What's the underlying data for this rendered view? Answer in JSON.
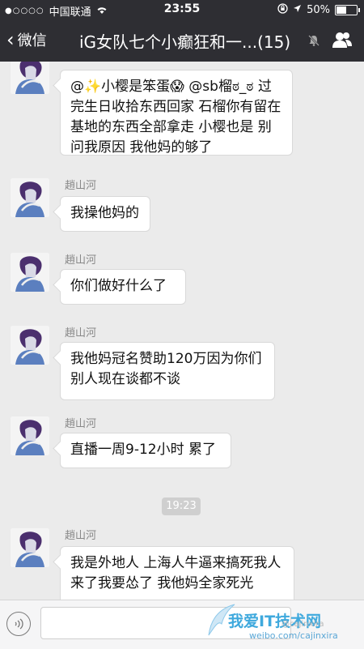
{
  "status_bar": {
    "carrier": "中国联通",
    "time": "23:55",
    "battery": "50%",
    "battery_level": 0.5
  },
  "nav": {
    "back_label": "微信",
    "title": "iG女队七个小癫狂和一...(15)"
  },
  "messages": [
    {
      "sender": "",
      "text": "@✨小樱是笨蛋😱 @sb榴ಠ_ಠ 过完生日收拾东西回家 石榴你有留在基地的东西全部拿走 小樱也是 别问我原因 我他妈的够了"
    },
    {
      "sender": "趙山河",
      "text": "我操他妈的"
    },
    {
      "sender": "趙山河",
      "text": "你们做好什么了"
    },
    {
      "sender": "趙山河",
      "text": "我他妈冠名赞助120万因为你们别人现在谈都不谈"
    },
    {
      "sender": "趙山河",
      "text": "直播一周9-12小时 累了"
    },
    {
      "sender": "趙山河",
      "text": "我是外地人 上海人牛逼来搞死我人来了我要怂了 我他妈全家死光"
    }
  ],
  "timestamp": "19:23",
  "watermark": {
    "main": "我爱IT技术网",
    "url": "weibo.com/cajinxira",
    "handle": "@cajinxira"
  },
  "icons": {
    "signal": "signal-dots-icon",
    "wifi": "wifi-icon",
    "lock_rotation": "orientation-lock-icon",
    "location": "location-arrow-icon",
    "mute": "mute-bell-icon",
    "contact": "contact-info-icon",
    "voice": "voice-input-icon"
  }
}
